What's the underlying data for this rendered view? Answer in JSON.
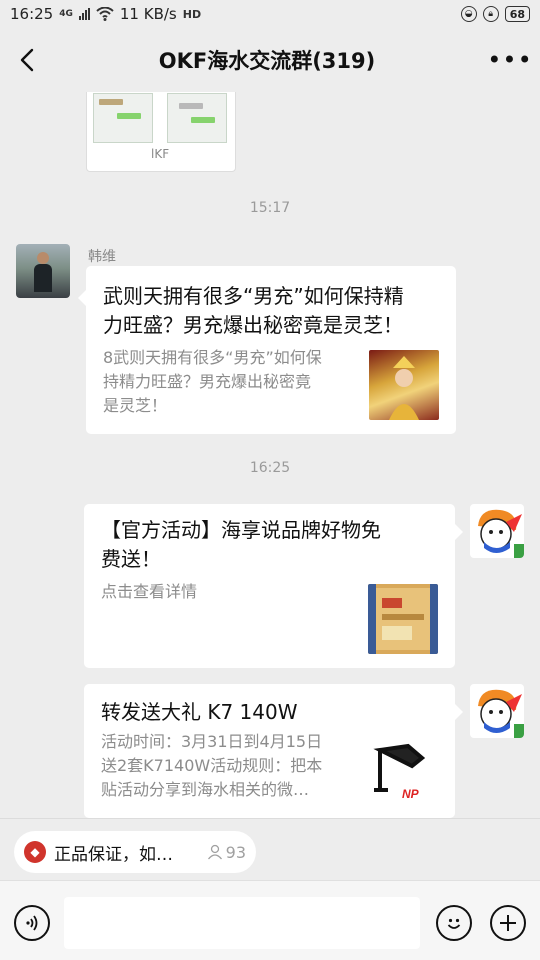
{
  "status_bar": {
    "time": "16:25",
    "network": "4G",
    "speed": "11 KB/s",
    "hd": "HD",
    "battery": "68"
  },
  "header": {
    "title": "OKF海水交流群(319)",
    "back_icon": "chevron-left-icon",
    "more_label": "•••"
  },
  "messages": {
    "image_caption": "lKF",
    "time1": "15:17",
    "msg1": {
      "sender": "韩维",
      "title_line1": "武则天拥有很多“男充”如何保持精",
      "title_line2": "力旺盛？男充爆出秘密竟是灵芝！",
      "desc_line1": "8武则天拥有很多“男充”如何保",
      "desc_line2": "持精力旺盛？男充爆出秘密竟",
      "desc_line3": "是灵芝！"
    },
    "time2": "16:25",
    "msg2": {
      "title_line1": "【官方活动】海享说品牌好物免",
      "title_line2": "费送！",
      "desc": "点击查看详情"
    },
    "msg3": {
      "title": "转发送大礼 K7 140W",
      "desc_line1": "活动时间：3月31日到4月15日",
      "desc_line2": "送2套K7140W活动规则：把本",
      "desc_line3": "贴活动分享到海水相关的微…",
      "thumb_label": "NP"
    }
  },
  "notice": {
    "text": "正品保证，如…",
    "count": "93"
  },
  "input": {
    "placeholder": ""
  },
  "colors": {
    "background": "#ededed",
    "notice_red": "#d0342c"
  }
}
